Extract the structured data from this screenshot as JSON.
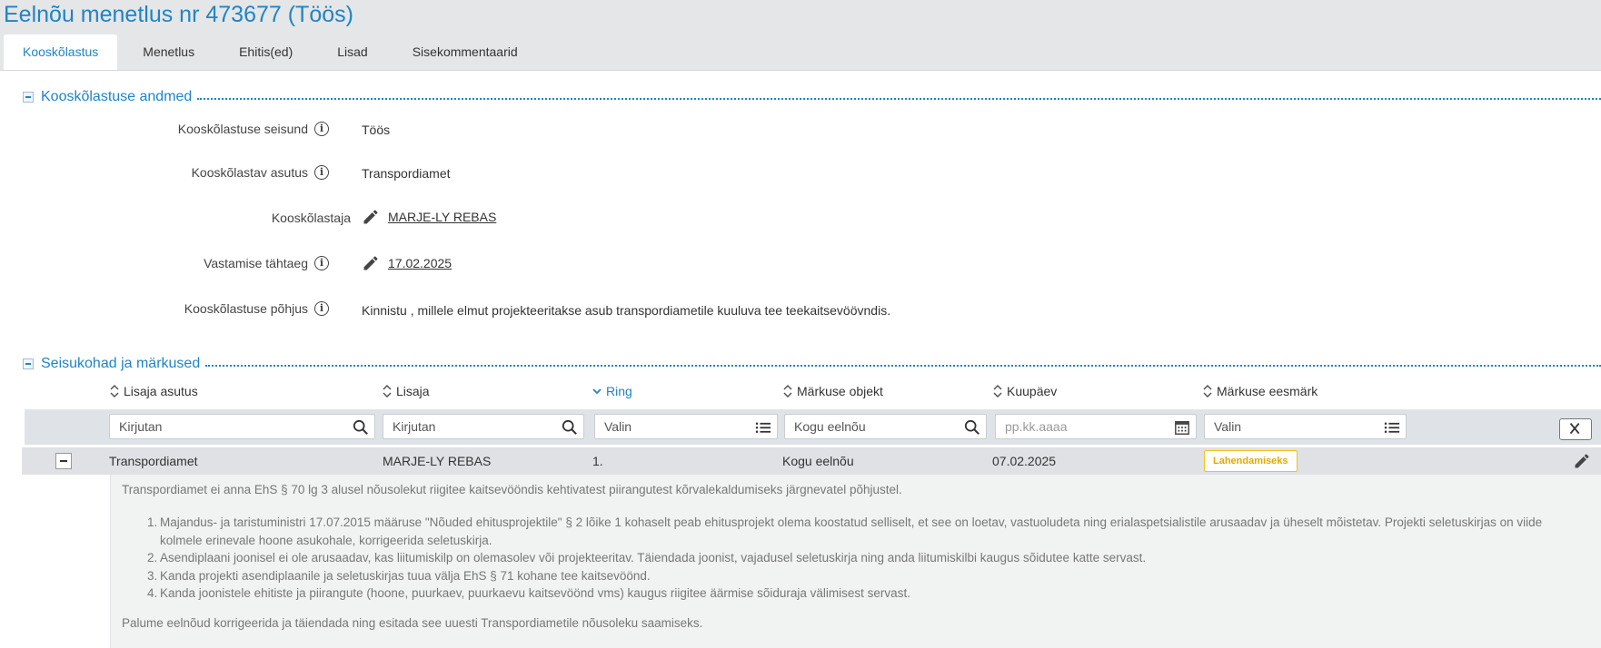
{
  "page": {
    "title": "Eelnõu menetlus nr 473677 (Töös)"
  },
  "tabs": [
    {
      "label": "Kooskõlastus",
      "active": true
    },
    {
      "label": "Menetlus"
    },
    {
      "label": "Ehitis(ed)"
    },
    {
      "label": "Lisad"
    },
    {
      "label": "Sisekommentaarid"
    }
  ],
  "section1": {
    "title": "Kooskõlastuse andmed",
    "fields": [
      {
        "label": "Kooskõlastuse seisund",
        "value": "Töös"
      },
      {
        "label": "Kooskõlastav asutus",
        "value": "Transpordiamet"
      },
      {
        "label": "Kooskõlastaja",
        "value": "MARJE-LY REBAS"
      },
      {
        "label": "Vastamise tähtaeg",
        "value": "17.02.2025"
      },
      {
        "label": "Kooskõlastuse põhjus",
        "value": "Kinnistu , millele elmut projekteeritakse asub transpordiametile kuuluva tee teekaitsevöövndis."
      }
    ]
  },
  "section2": {
    "title": "Seisukohad ja märkused",
    "columns": [
      "Lisaja asutus",
      "Lisaja",
      "Ring",
      "Märkuse objekt",
      "Kuupäev",
      "Märkuse eesmärk"
    ],
    "filters": {
      "lisaja_asutus": "Kirjutan",
      "lisaja": "Kirjutan",
      "ring": "Valin",
      "objekt": "Kogu eelnõu",
      "kuupaev": "pp.kk.aaaa",
      "eesmark": "Valin"
    },
    "row": {
      "lisaja_asutus": "Transpordiamet",
      "lisaja": "MARJE-LY REBAS",
      "ring": "1.",
      "objekt": "Kogu eelnõu",
      "kuupaev": "07.02.2025",
      "eesmark": "Lahendamiseks"
    },
    "detail": {
      "intro": "Transpordiamet ei anna EhS § 70 lg 3 alusel nõusolekut riigitee kaitsevööndis kehtivatest piirangutest kõrvalekaldumiseks järgnevatel põhjustel.",
      "items": [
        {
          "num": "1.",
          "line1": "Majandus- ja taristuministri 17.07.2015 määruse \"Nõuded ehitusprojektile\" § 2 lõike 1 kohaselt peab ehitusprojekt olema koostatud selliselt, et see on loetav, vastuoludeta ning erialaspetsialistile arusaadav ja üheselt mõistetav. Projekti seletuskirjas on viide",
          "line2": "kolmele erinevale hoone asukohale, korrigeerida seletuskirja."
        },
        {
          "num": "2.",
          "line1": "Asendiplaani joonisel ei ole arusaadav, kas liitumiskilp on olemasolev või projekteeritav. Täiendada joonist, vajadusel seletuskirja ning anda liitumiskilbi kaugus sõidutee katte servast."
        },
        {
          "num": "3.",
          "line1": "Kanda projekti asendiplaanile ja seletuskirjas tuua välja EhS § 71 kohane tee kaitsevöönd."
        },
        {
          "num": "4.",
          "line1": "Kanda joonistele ehitiste ja piirangute (hoone, puurkaev, puurkaevu kaitsevöönd vms) kaugus riigitee äärmise sõiduraja välimisest servast."
        }
      ],
      "closing": "Palume eelnõud korrigeerida ja täiendada ning esitada see uuesti Transpordiametile nõusoleku saamiseks."
    }
  },
  "colors": {
    "accent": "#1f84c5",
    "badge": "#f2c21b",
    "ok": "#5cb85c"
  }
}
